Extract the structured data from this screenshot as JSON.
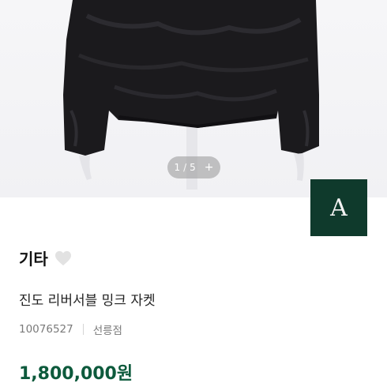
{
  "image": {
    "counter": {
      "current": "1",
      "separator": "/",
      "total": "5",
      "plus_symbol": "+"
    }
  },
  "brand": {
    "logo_letter": "A",
    "logo_color": "#0f3a2c",
    "name": "기타",
    "wishlist_icon": "heart-icon"
  },
  "product": {
    "name": "진도 리버서블 밍크 자켓",
    "code": "10076527",
    "tag": "선릉점",
    "price": "1,800,000원",
    "price_color": "#0d5a3c"
  }
}
